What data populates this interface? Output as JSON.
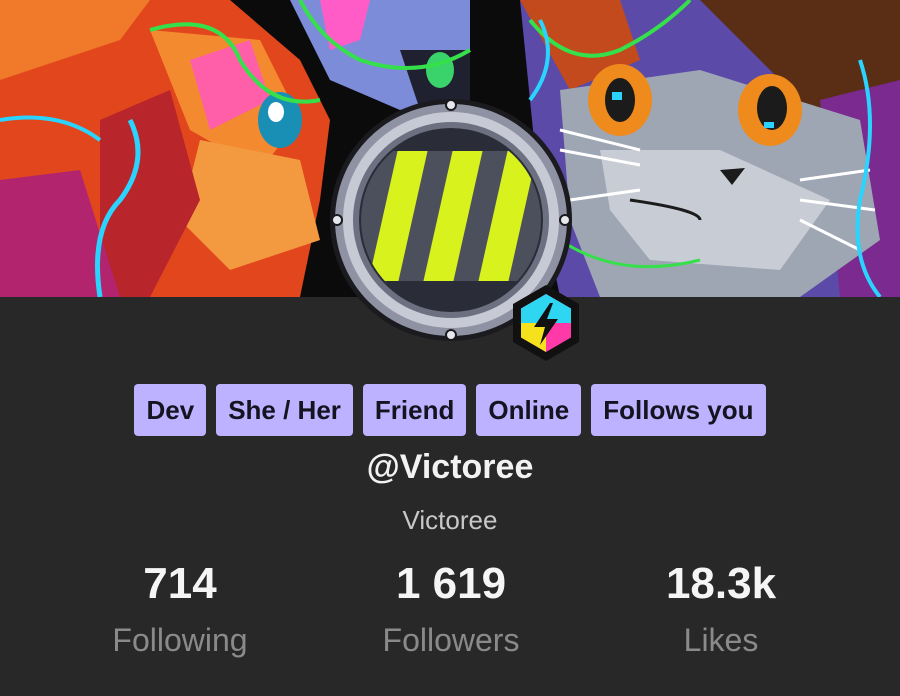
{
  "tags": [
    "Dev",
    "She / Her",
    "Friend",
    "Online",
    "Follows you"
  ],
  "profile": {
    "handle": "@Victoree",
    "display_name": "Victoree"
  },
  "stats": {
    "following": {
      "value": "714",
      "label": "Following"
    },
    "followers": {
      "value": "1 619",
      "label": "Followers"
    },
    "likes": {
      "value": "18.3k",
      "label": "Likes"
    }
  },
  "colors": {
    "background": "#282828",
    "tag_bg": "#bcb2ff",
    "tag_text": "#141420",
    "stat_label": "#8a8a8a",
    "avatar_stripe": "#d7f21d"
  },
  "icons": {
    "avatar": "hazard-stripe-porthole",
    "badge": "lightning-hexagon"
  }
}
